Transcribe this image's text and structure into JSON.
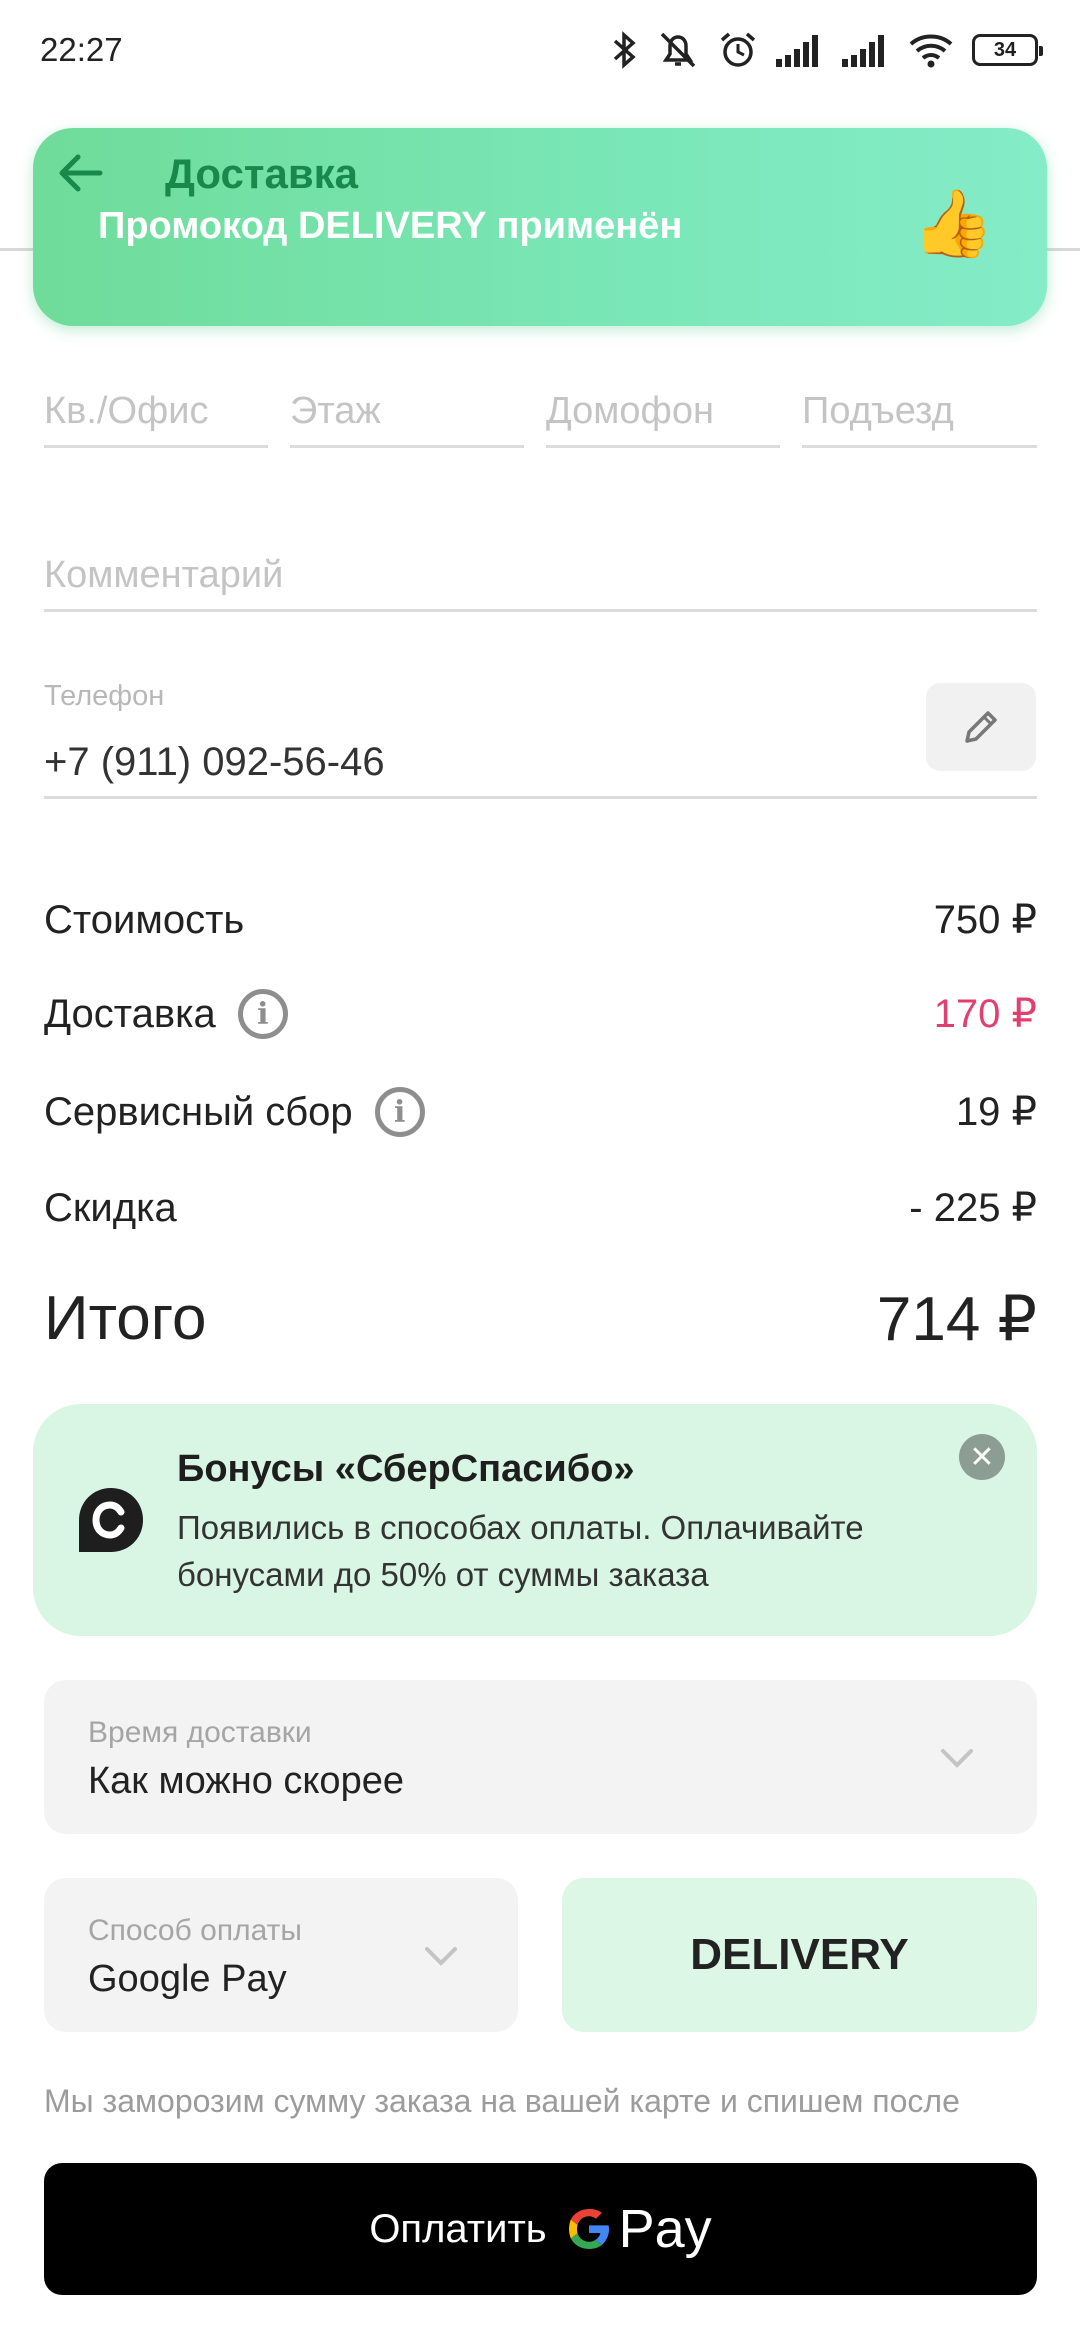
{
  "status_bar": {
    "time": "22:27",
    "battery": "34"
  },
  "header": {
    "title": "Доставка"
  },
  "toast": {
    "text": "Промокод DELIVERY применён",
    "emoji": "👍"
  },
  "address": {
    "apartment_placeholder": "Кв./Офис",
    "floor_placeholder": "Этаж",
    "intercom_placeholder": "Домофон",
    "entrance_placeholder": "Подъезд",
    "comment_placeholder": "Комментарий"
  },
  "phone": {
    "label": "Телефон",
    "value": "+7 (911) 092-56-46"
  },
  "summary": {
    "cost_label": "Стоимость",
    "cost_value": "750 ₽",
    "delivery_label": "Доставка",
    "delivery_value": "170 ₽",
    "service_label": "Сервисный сбор",
    "service_value": "19 ₽",
    "discount_label": "Скидка",
    "discount_value": "- 225 ₽",
    "total_label": "Итого",
    "total_value": "714 ₽"
  },
  "bonus": {
    "title": "Бонусы «СберСпасибо»",
    "text": "Появились в способах оплаты. Оплачивайте бонусами до 50% от суммы заказа"
  },
  "delivery_time": {
    "label": "Время доставки",
    "value": "Как можно скорее"
  },
  "payment_method": {
    "label": "Способ оплаты",
    "value": "Google Pay"
  },
  "promo": {
    "code": "DELIVERY"
  },
  "note": "Мы заморозим сумму заказа на вашей карте и спишем после",
  "pay_button": {
    "label": "Оплатить",
    "brand": "Pay"
  },
  "colors": {
    "accent_green": "#18894a",
    "delivery_price": "#e0406e",
    "toast_bg": "#7ae7b8"
  }
}
